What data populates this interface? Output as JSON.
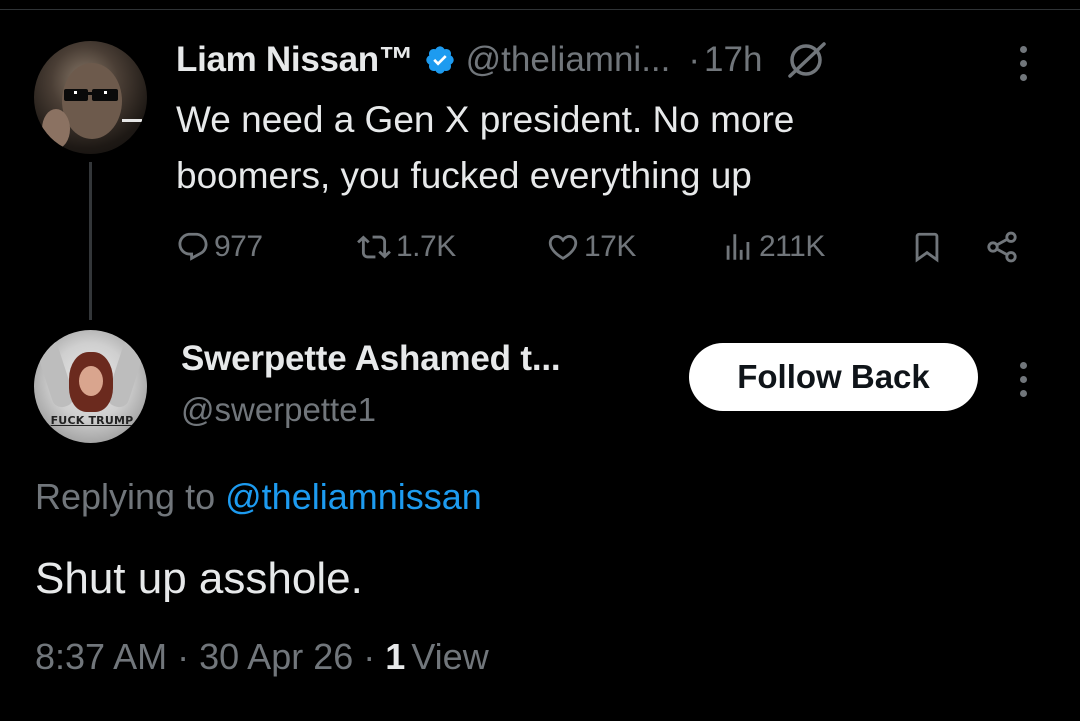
{
  "parent_tweet": {
    "display_name": "Liam Nissan™",
    "handle": "@theliamni...",
    "separator": "·",
    "time": "17h",
    "text": "We need a Gen X president. No more boomers, you fucked everything up",
    "stats": {
      "replies": "977",
      "reposts": "1.7K",
      "likes": "17K",
      "views": "211K"
    },
    "icons": {
      "verified": "verified-badge-icon",
      "grok": "grok-icon",
      "more": "more-options-icon",
      "reply": "reply-icon",
      "repost": "repost-icon",
      "like": "heart-icon",
      "views": "views-chart-icon",
      "bookmark": "bookmark-icon",
      "share": "share-icon"
    }
  },
  "reply": {
    "display_name": "Swerpette Ashamed t...",
    "handle": "@swerpette1",
    "avatar_sign": "FUCK TRUMP",
    "follow_button": "Follow Back",
    "replying_label": "Replying to",
    "replying_to": "@theliamnissan",
    "text": "Shut up asshole.",
    "meta": {
      "time": "8:37 AM",
      "sep1": "·",
      "date": "30 Apr 26",
      "sep2": "·",
      "views_count": "1",
      "views_label": "View"
    }
  },
  "colors": {
    "background": "#000000",
    "primary_text": "#e7e9ea",
    "secondary_text": "#71767b",
    "accent": "#1d9bf0",
    "divider": "#2f3336"
  }
}
